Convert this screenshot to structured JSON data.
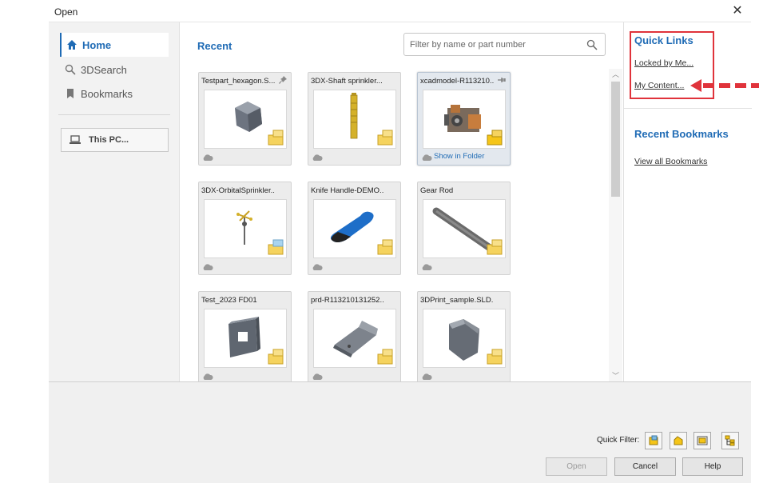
{
  "window": {
    "title": "Open"
  },
  "sidebar": {
    "items": [
      {
        "label": "Home",
        "icon": "home-icon",
        "active": true
      },
      {
        "label": "3DSearch",
        "icon": "search-icon",
        "active": false
      },
      {
        "label": "Bookmarks",
        "icon": "bookmark-icon",
        "active": false
      }
    ],
    "this_pc": "This PC..."
  },
  "recent": {
    "title": "Recent",
    "filter_placeholder": "Filter by name or part number",
    "items": [
      {
        "name": "Testpart_hexagon.S...",
        "thumb": "hexagon-part"
      },
      {
        "name": "3DX-Shaft sprinkler...",
        "thumb": "shaft-part"
      },
      {
        "name": "xcadmodel-R113210...",
        "thumb": "motor-assembly",
        "show_in_folder": "Show in Folder"
      },
      {
        "name": "3DX-OrbitalSprinkler...",
        "thumb": "sprinkler-assembly"
      },
      {
        "name": "Knife Handle-DEMO...",
        "thumb": "knife-handle-part"
      },
      {
        "name": "Gear Rod",
        "thumb": "gear-rod-part"
      },
      {
        "name": "Test_2023 FD01",
        "thumb": "plate-part"
      },
      {
        "name": "prd-R113210131252...",
        "thumb": "bracket-part"
      },
      {
        "name": "3DPrint_sample.SLD...",
        "thumb": "print-sample-part"
      }
    ]
  },
  "quick_links": {
    "title": "Quick Links",
    "links": [
      "Locked by Me...",
      "My Content..."
    ]
  },
  "recent_bookmarks": {
    "title": "Recent Bookmarks",
    "link": "View all Bookmarks"
  },
  "footer": {
    "quick_filter_label": "Quick Filter:",
    "quick_filters": [
      "filter-assemblies-icon",
      "filter-parts-icon",
      "filter-drawings-icon",
      "filter-top-level-icon"
    ],
    "open_label": "Open",
    "cancel_label": "Cancel",
    "help_label": "Help"
  },
  "colors": {
    "accent": "#1f6bb5",
    "highlight": "#e0333b",
    "part_badge": "#f5c518"
  }
}
